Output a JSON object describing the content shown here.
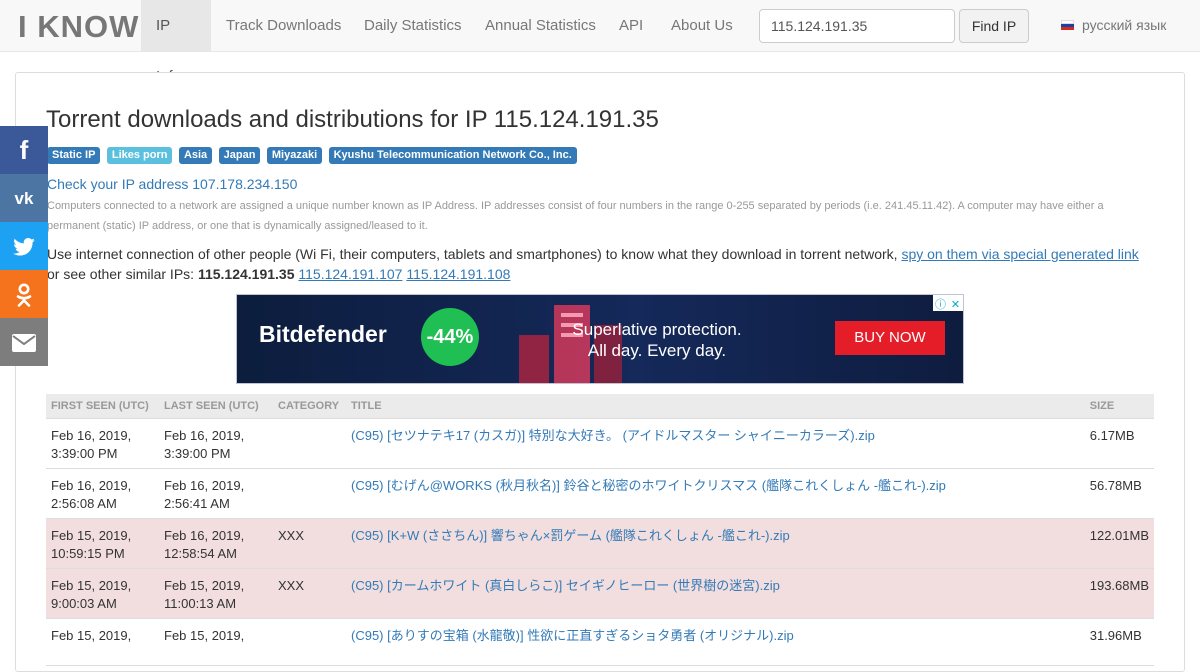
{
  "nav": {
    "brand": "I KNOW",
    "items": [
      {
        "label": "IP Info",
        "active": true
      },
      {
        "label": "Track Downloads"
      },
      {
        "label": "Daily Statistics"
      },
      {
        "label": "Annual Statistics"
      },
      {
        "label": "API"
      },
      {
        "label": "About Us"
      }
    ],
    "search_value": "115.124.191.35",
    "find_button": "Find IP",
    "language": "русский язык"
  },
  "social": [
    "f",
    "vk",
    "twitter",
    "ok",
    "email"
  ],
  "main": {
    "title": "Torrent downloads and distributions for IP 115.124.191.35",
    "labels": [
      {
        "text": "Static IP",
        "style": "blue"
      },
      {
        "text": "Likes porn",
        "style": "info"
      },
      {
        "text": "Asia",
        "style": "blue"
      },
      {
        "text": "Japan",
        "style": "blue"
      },
      {
        "text": "Miyazaki",
        "style": "blue"
      },
      {
        "text": "Kyushu Telecommunication Network Co., Inc.",
        "style": "blue"
      }
    ],
    "check_link": "Check your IP address 107.178.234.150",
    "explanation": "Computers connected to a network are assigned a unique number known as IP Address. IP addresses consist of four numbers in the range 0-255 separated by periods (i.e. 241.45.11.42). A computer may have either a permanent (static) IP address, or one that is dynamically assigned/leased to it.",
    "spy_text": "Use internet connection of other people (Wi Fi, their computers, tablets and smartphones) to know what they download in torrent network, ",
    "spy_link": "spy on them via special generated link",
    "similar_text": "or see other similar IPs: ",
    "similar_current": "115.124.191.35",
    "similar_links": [
      "115.124.191.107",
      "115.124.191.108"
    ]
  },
  "ad": {
    "brand": "Bitdefender",
    "discount": "-44%",
    "line1": "Superlative protection.",
    "line2": "All day. Every day.",
    "cta": "BUY NOW"
  },
  "table": {
    "headers": [
      "FIRST SEEN (UTC)",
      "LAST SEEN (UTC)",
      "CATEGORY",
      "TITLE",
      "SIZE"
    ],
    "rows": [
      {
        "first": [
          "Feb 16, 2019,",
          "3:39:00 PM"
        ],
        "last": [
          "Feb 16, 2019,",
          "3:39:00 PM"
        ],
        "category": "",
        "title": "(C95) [セツナテキ17 (カスガ)] 特別な大好き。 (アイドルマスター シャイニーカラーズ).zip",
        "size": "6.17MB",
        "danger": false
      },
      {
        "first": [
          "Feb 16, 2019,",
          "2:56:08 AM"
        ],
        "last": [
          "Feb 16, 2019,",
          "2:56:41 AM"
        ],
        "category": "",
        "title": "(C95) [むげん@WORKS (秋月秋名)] 鈴谷と秘密のホワイトクリスマス (艦隊これくしょん -艦これ-).zip",
        "size": "56.78MB",
        "danger": false
      },
      {
        "first": [
          "Feb 15, 2019,",
          "10:59:15 PM"
        ],
        "last": [
          "Feb 16, 2019,",
          "12:58:54 AM"
        ],
        "category": "XXX",
        "title": "(C95) [K+W (ささちん)] 響ちゃん×罰ゲーム (艦隊これくしょん -艦これ-).zip",
        "size": "122.01MB",
        "danger": true
      },
      {
        "first": [
          "Feb 15, 2019,",
          "9:00:03 AM"
        ],
        "last": [
          "Feb 15, 2019,",
          "11:00:13 AM"
        ],
        "category": "XXX",
        "title": "(C95) [カームホワイト (真白しらこ)] セイギノヒーロー (世界樹の迷宮).zip",
        "size": "193.68MB",
        "danger": true
      },
      {
        "first": [
          "Feb 15, 2019,",
          ""
        ],
        "last": [
          "Feb 15, 2019,",
          ""
        ],
        "category": "",
        "title": "(C95) [ありすの宝箱 (水龍敬)] 性欲に正直すぎるショタ勇者 (オリジナル).zip",
        "size": "31.96MB",
        "danger": false
      }
    ]
  }
}
